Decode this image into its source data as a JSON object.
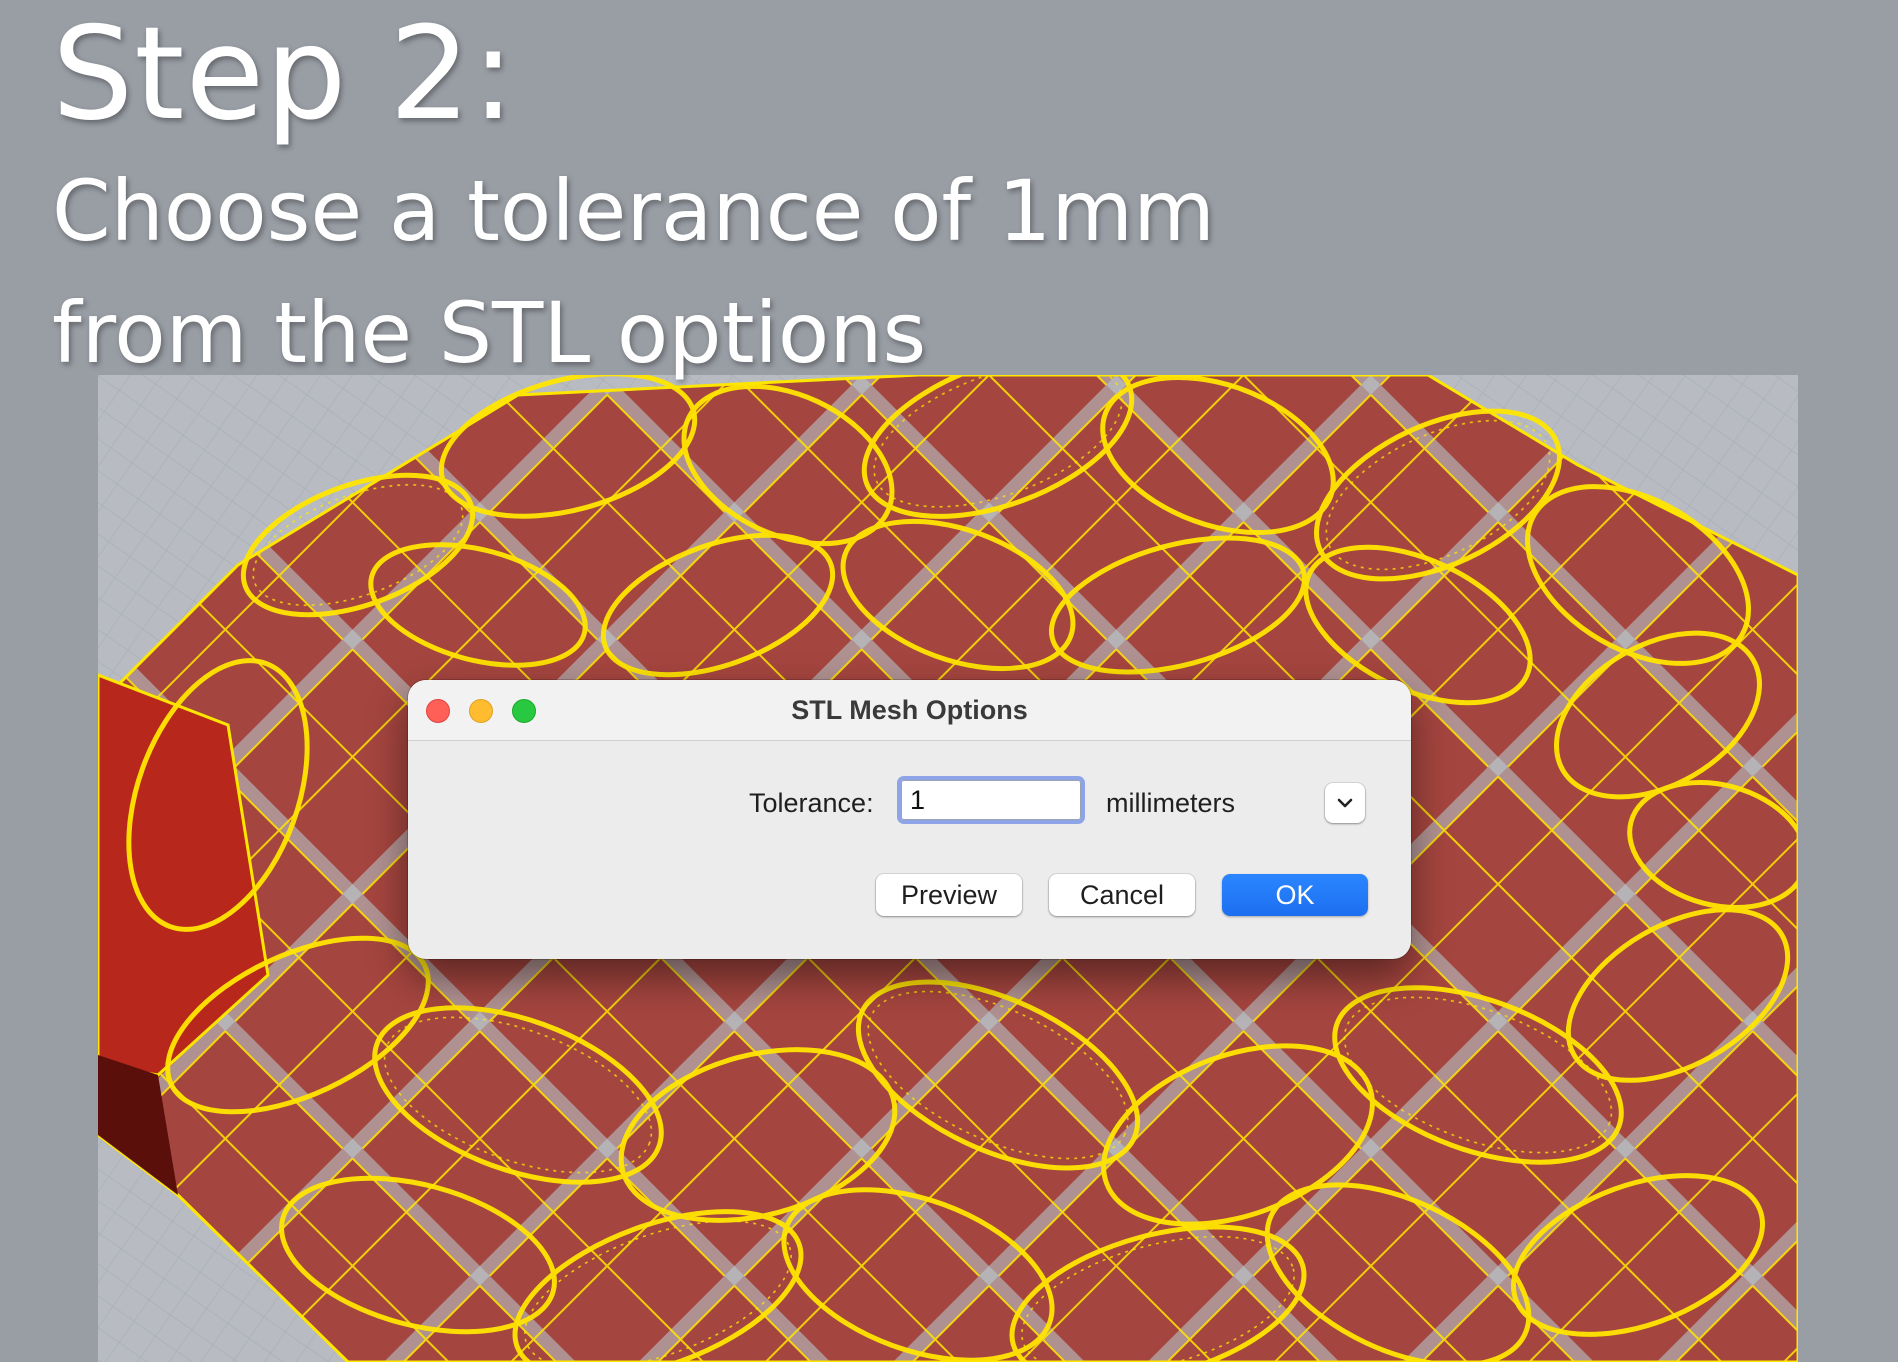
{
  "overlay": {
    "step": "Step 2:",
    "instruction_line1": "Choose a tolerance of 1mm",
    "instruction_line2": "from the STL options"
  },
  "dialog": {
    "title": "STL Mesh Options",
    "tolerance_label": "Tolerance:",
    "tolerance_value": "1",
    "units_label": "millimeters",
    "preview_label": "Preview",
    "cancel_label": "Cancel",
    "ok_label": "OK"
  },
  "colors": {
    "background": "#999ea5",
    "mesh_fill": "#a5453f",
    "wireframe": "#ffe600",
    "ok_button": "#1c6ff0"
  }
}
